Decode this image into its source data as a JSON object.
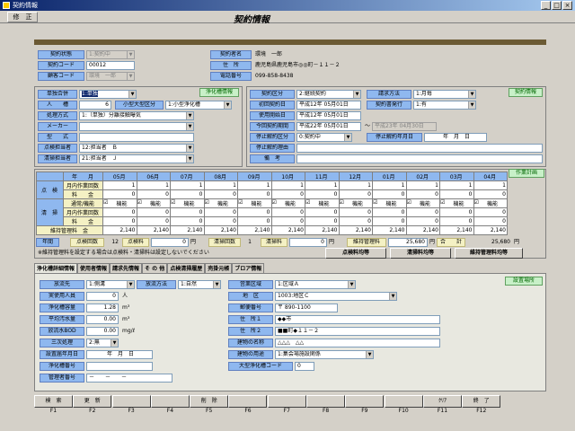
{
  "window": {
    "title": "契約情報",
    "min": "_",
    "max": "□",
    "close": "×"
  },
  "menu": {
    "edit": "修　正"
  },
  "page_title": "契約情報",
  "header": {
    "contract_status_label": "契約状態",
    "contract_status_value": "1:契約中",
    "contract_code_label": "契約コード",
    "contract_code_value": "00012",
    "customer_code_label": "顧客コード",
    "customer_code_value": "環境　一郎",
    "contractor_label": "契約者名",
    "contractor_value": "環境　一郎",
    "address_label": "住　所",
    "address_value": "鹿児島県鹿児島市◎◎町－１１－２",
    "phone_label": "電話番号",
    "phone_value": "099-858-8438"
  },
  "left_info": {
    "badge": "浄化槽情報",
    "tank_count_label": "単独合併",
    "tank_count_value": "1:単独",
    "persons_label": "人　　槽",
    "persons_value": "6",
    "size_label": "小型大型区分",
    "size_value": "1:小型浄化槽",
    "method_label": "処理方式",
    "method_value": "1:（単独）分離接触曝気",
    "maker_label": "メーカー",
    "maker_value": "",
    "model_label": "型　　式",
    "model_value": "",
    "inspector_label": "点検担当者",
    "inspector_value": "12:担当者　Ｂ",
    "cleaner_label": "清掃担当者",
    "cleaner_value": "21:担当者　Ｊ"
  },
  "right_info": {
    "badge": "契約情報",
    "type_label": "契約区分",
    "type_value": "2:継続契約",
    "billing_label": "請求方法",
    "billing_value": "1:月毎",
    "first_label": "初回契約日",
    "first_value": "平成12年 05月01日",
    "issue_label": "契約書発行",
    "issue_value": "1:有",
    "start_label": "使用開始日",
    "start_value": "平成12年 05月01日",
    "current_label": "今回契約期間",
    "current_from": "平成22年 05月01日",
    "tilde": "～",
    "current_to": "平成23年 04月30日",
    "stop_label": "停止解約区分",
    "stop_value": "0:契約中",
    "stopdate_label": "停止解約年月日",
    "stopdate_value": "年　月　日",
    "reason_label": "停止解約理由",
    "reason_value": "",
    "note_label": "備　考",
    "note_value": ""
  },
  "plan": {
    "badge": "作業計画",
    "head": [
      "年　　月",
      "05月",
      "06月",
      "07月",
      "08月",
      "09月",
      "10月",
      "11月",
      "12月",
      "01月",
      "02月",
      "03月",
      "04月"
    ],
    "inspect_label": "点　検",
    "inspect_rows": [
      {
        "label": "月内作業回数",
        "vals": [
          "1",
          "1",
          "1",
          "1",
          "1",
          "1",
          "1",
          "1",
          "1",
          "1",
          "1",
          "1"
        ]
      },
      {
        "label": "料　　金",
        "vals": [
          "0",
          "0",
          "0",
          "0",
          "0",
          "0",
          "0",
          "0",
          "0",
          "0",
          "0",
          "0"
        ]
      }
    ],
    "clean_label": "清　掃",
    "clean_rows": [
      {
        "label": "通常/機能",
        "vals": [
          "機能",
          "機能",
          "機能",
          "機能",
          "機能",
          "機能",
          "機能",
          "機能",
          "機能",
          "機能",
          "機能",
          "機能"
        ]
      },
      {
        "label": "月内作業回数",
        "vals": [
          "0",
          "0",
          "0",
          "0",
          "0",
          "0",
          "0",
          "0",
          "0",
          "0",
          "0",
          "0"
        ]
      },
      {
        "label": "料　　金",
        "vals": [
          "0",
          "0",
          "0",
          "0",
          "0",
          "0",
          "0",
          "0",
          "0",
          "0",
          "0",
          "0"
        ]
      }
    ],
    "maint_row": {
      "label": "維持管理料　金",
      "vals": [
        "2,140",
        "2,140",
        "2,140",
        "2,140",
        "2,140",
        "2,140",
        "2,140",
        "2,140",
        "2,140",
        "2,140",
        "2,140",
        "2,140"
      ]
    },
    "summary": {
      "year_label": "年間",
      "ins_count_label": "点検回数",
      "ins_count": "12",
      "ins_fee_label": "点検料",
      "ins_fee": "0",
      "yen1": "円",
      "cl_count_label": "清掃回数",
      "cl_count": "1",
      "cl_fee_label": "清掃料",
      "cl_fee": "0",
      "yen2": "円",
      "mt_fee_label": "維持管理料",
      "mt_fee": "25,680",
      "yen3": "円",
      "total_label": "合　　計",
      "total": "25,680",
      "yen4": "円"
    },
    "note": "※維持管理料を設定する場合は点検料・清掃料は設定しないでください",
    "btn_inspect": "点検料均等",
    "btn_clean": "清掃料均等",
    "btn_maint": "維持管理料均等"
  },
  "tabs": [
    "浄化槽詳細情報",
    "使用者情報",
    "請求先情報",
    "そ の 他",
    "点検清掃履歴",
    "売掛元帳",
    "ブロア情報"
  ],
  "detail": {
    "badge": "設置場所",
    "discharge_label": "放流先",
    "discharge_value": "1:側溝",
    "discharge_method_label": "放流方法",
    "discharge_method_value": "1:自然",
    "actual_label": "実使用人員",
    "actual_value": "0",
    "actual_unit": "人",
    "volume_label": "浄化槽容量",
    "volume_value": "1.28",
    "volume_unit": "m³",
    "avg_label": "平均汚水量",
    "avg_value": "0.00",
    "avg_unit": "m³",
    "bod_label": "放流水BOD",
    "bod_value": "0.00",
    "bod_unit": "mg/ℓ",
    "tertiary_label": "三次処理",
    "tertiary_value": "2:無",
    "install_label": "設置届年月日",
    "install_value": "年　月　日",
    "tank_no_label": "浄化槽番号",
    "tank_no_value": "",
    "mgmt_no_label": "管理者番号",
    "mgmt_no_value": "－　　－　　－",
    "area_label": "営業区域",
    "area_value": "1:区域Ａ",
    "district_label": "地　区",
    "district_value": "1003:地区Ｃ",
    "zip_label": "郵便番号",
    "zip_value": "〒 890-1100",
    "addr1_label": "住　所１",
    "addr1_value": "◆◆市",
    "addr2_label": "住　所２",
    "addr2_value": "■■町◆１１－２",
    "building_label": "建物の名称",
    "building_value": "△△△　△△",
    "usage_label": "建物の用途",
    "usage_value": "1:集会場施設関係",
    "large_code_label": "大型浄化槽コード",
    "large_code_value": "0"
  },
  "fkeys": [
    {
      "label": "検　索",
      "key": "F1"
    },
    {
      "label": "更　新",
      "key": "F2"
    },
    {
      "label": "",
      "key": "F3"
    },
    {
      "label": "",
      "key": "F4"
    },
    {
      "label": "削　除",
      "key": "F5"
    },
    {
      "label": "",
      "key": "F6"
    },
    {
      "label": "",
      "key": "F7"
    },
    {
      "label": "",
      "key": "F8"
    },
    {
      "label": "",
      "key": "F9"
    },
    {
      "label": "",
      "key": "F10"
    },
    {
      "label": "ｸﾘｱ",
      "key": "F11"
    },
    {
      "label": "終　了",
      "key": "F12"
    }
  ]
}
